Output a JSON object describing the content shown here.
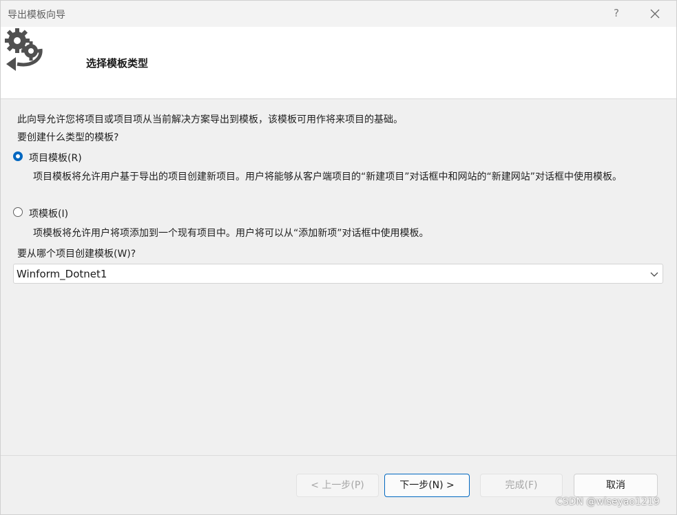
{
  "window": {
    "title": "导出模板向导",
    "help_label": "?"
  },
  "header": {
    "heading": "选择模板类型"
  },
  "body": {
    "intro": "此向导允许您将项目或项目项从当前解决方案导出到模板，该模板可用作将来项目的基础。",
    "question_type": "要创建什么类型的模板?",
    "options": [
      {
        "label": "项目模板(R)",
        "selected": true,
        "description": "项目模板将允许用户基于导出的项目创建新项目。用户将能够从客户端项目的“新建项目”对话框中和网站的“新建网站”对话框中使用模板。"
      },
      {
        "label": "项模板(I)",
        "selected": false,
        "description": "项模板将允许用户将项添加到一个现有项目中。用户将可以从“添加新项”对话框中使用模板。"
      }
    ],
    "question_project": "要从哪个项目创建模板(W)?",
    "project_select": {
      "value": "Winform_Dotnet1"
    }
  },
  "buttons": {
    "prev": "< 上一步(P)",
    "next": "下一步(N) >",
    "finish": "完成(F)",
    "cancel": "取消"
  },
  "watermark": "CSDN @wiseyao1219",
  "colors": {
    "accent": "#0067c0",
    "header_background": "#ffffff",
    "body_background": "#f0f0f0"
  },
  "icons": {
    "header": "gears-export-icon",
    "close": "close-icon",
    "dropdown": "chevron-down-icon"
  }
}
